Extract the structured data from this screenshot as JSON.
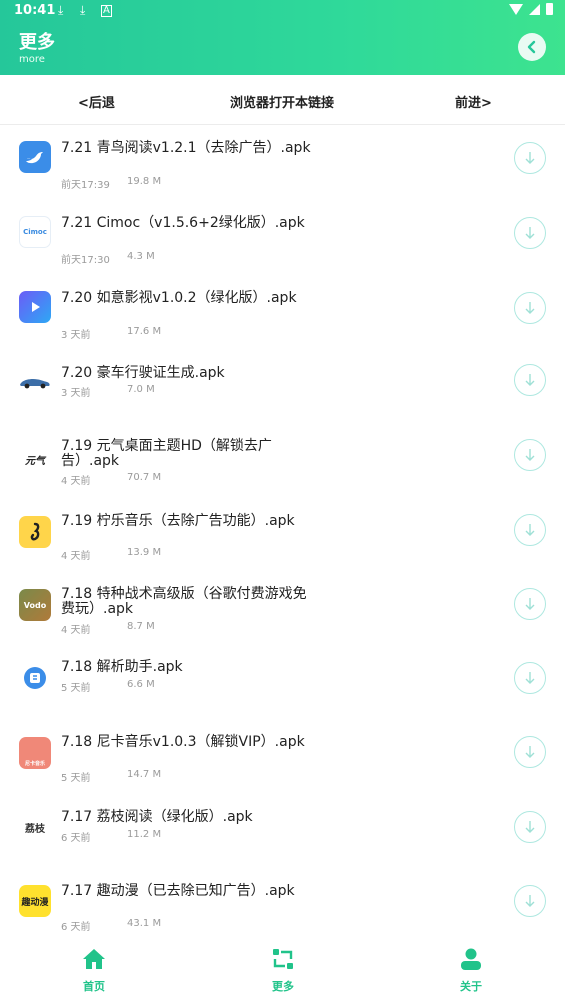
{
  "status": {
    "time": "10:41",
    "dl1": "⤓",
    "dl2": "⤓",
    "a": "A"
  },
  "header": {
    "title": "更多",
    "subtitle": "more"
  },
  "nav": {
    "back": "<后退",
    "open": "浏览器打开本链接",
    "forward": "前进>"
  },
  "items": [
    {
      "title": "7.21 青鸟阅读v1.2.1（去除广告）.apk",
      "time": "前天17:39",
      "size": "19.8 M",
      "icon": "bird-icon"
    },
    {
      "title": "7.21 Cimoc（v1.5.6+2绿化版）.apk",
      "time": "前天17:30",
      "size": "4.3 M",
      "icon": "cimoc-icon"
    },
    {
      "title": "7.20 如意影视v1.0.2（绿化版）.apk",
      "time": "3 天前",
      "size": "17.6 M",
      "icon": "play-icon"
    },
    {
      "title": "7.20 豪车行驶证生成.apk",
      "time": "3 天前",
      "size": "7.0 M",
      "icon": "car-icon"
    },
    {
      "title": "7.19 元气桌面主题HD（解锁去广告）.apk",
      "time": "4 天前",
      "size": "70.7 M",
      "icon": "yuanqi-icon"
    },
    {
      "title": "7.19 柠乐音乐（去除广告功能）.apk",
      "time": "4 天前",
      "size": "13.9 M",
      "icon": "music-note-icon"
    },
    {
      "title": "7.18 特种战术高级版（谷歌付费游戏免费玩）.apk",
      "time": "4 天前",
      "size": "8.7 M",
      "icon": "game-icon"
    },
    {
      "title": "7.18 解析助手.apk",
      "time": "5 天前",
      "size": "6.6 M",
      "icon": "parse-icon"
    },
    {
      "title": "7.18 尼卡音乐v1.0.3（解锁VIP）.apk",
      "time": "5 天前",
      "size": "14.7 M",
      "icon": "nika-icon"
    },
    {
      "title": "7.17 荔枝阅读（绿化版）.apk",
      "time": "6 天前",
      "size": "11.2 M",
      "icon": "lizhi-icon"
    },
    {
      "title": "7.17 趣动漫（已去除已知广告）.apk",
      "time": "6 天前",
      "size": "43.1 M",
      "icon": "qudongman-icon"
    }
  ],
  "icon_text": {
    "cimoc": "Cimoc",
    "yuanqi": "元气",
    "game": "Vodo",
    "lizhi": "荔枝",
    "qudongman": "趣动漫",
    "nika": "尼卡音乐"
  },
  "tabs": {
    "home": "首页",
    "more": "更多",
    "about": "关于"
  },
  "colors": {
    "accent": "#21c38a",
    "header_start": "#25c79a",
    "header_end": "#3de38f"
  }
}
